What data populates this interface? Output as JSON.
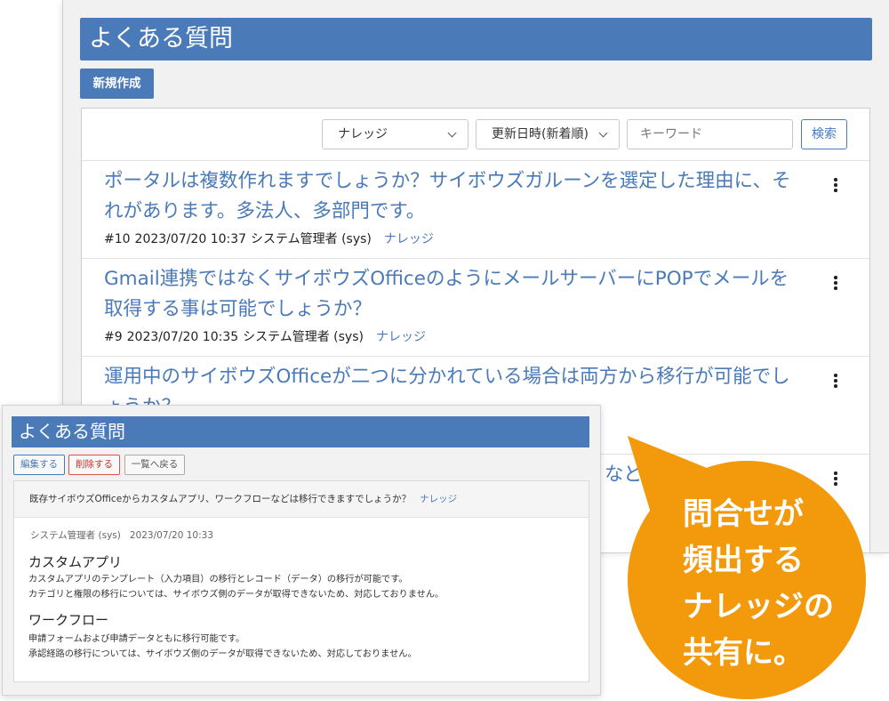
{
  "list_view": {
    "title": "よくある質問",
    "new_button": "新規作成",
    "filters": {
      "category": "ナレッジ",
      "sort": "更新日時(新着順)",
      "keyword_placeholder": "キーワード",
      "search_button": "検索"
    },
    "items": [
      {
        "title": "ポータルは複数作れますでしょうか？サイボウズガルーンを選定した理由に、それがあります。多法人、多部門です。",
        "meta": {
          "id": "#10",
          "datetime": "2023/07/20 10:37",
          "author": "システム管理者 (sys)",
          "category": "ナレッジ"
        }
      },
      {
        "title": "Gmail連携ではなくサイボウズOfficeのようにメールサーバーにPOPでメールを取得する事は可能でしょうか？",
        "meta": {
          "id": "#9",
          "datetime": "2023/07/20 10:35",
          "author": "システム管理者 (sys)",
          "category": "ナレッジ"
        }
      },
      {
        "title": "運用中のサイボウズOfficeが二つに分かれている場合は両方から移行が可能でしょうか？"
      },
      {
        "title": "など"
      }
    ]
  },
  "detail_view": {
    "title": "よくある質問",
    "buttons": {
      "edit": "編集する",
      "delete": "削除する",
      "back": "一覧へ戻る"
    },
    "question": "既存サイボウズOfficeからカスタムアプリ、ワークフローなどは移行できますでしょうか？",
    "category": "ナレッジ",
    "author": "システム管理者 (sys)",
    "datetime": "2023/07/20 10:33",
    "sections": [
      {
        "heading": "カスタムアプリ",
        "lines": [
          "カスタムアプリのテンプレート（入力項目）の移行とレコード（データ）の移行が可能です。",
          "カテゴリと権限の移行については、サイボウズ側のデータが取得できないため、対応しておりません。"
        ]
      },
      {
        "heading": "ワークフロー",
        "lines": [
          "申請フォームおよび申請データともに移行可能です。",
          "承認経路の移行については、サイボウズ側のデータが取得できないため、対応しておりません。"
        ]
      }
    ]
  },
  "callout": {
    "lines": [
      "問合せが",
      "頻出する",
      "ナレッジの",
      "共有に。"
    ]
  },
  "icons": {
    "select_arrow": "chevron-down-icon",
    "item_menu": "kebab-menu-icon"
  },
  "colors": {
    "primary": "#4a7ab8",
    "link": "#4a7ab8",
    "danger": "#c9302c",
    "callout": "#f39a0c"
  }
}
